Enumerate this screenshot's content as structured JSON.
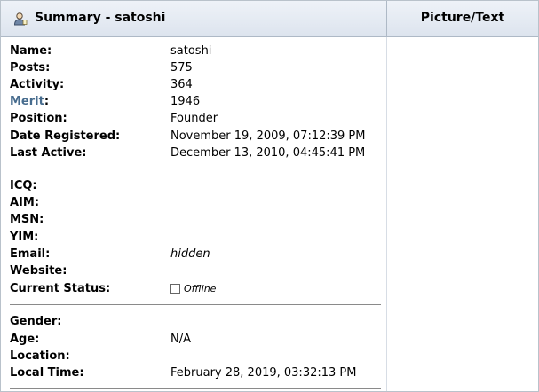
{
  "header": {
    "title": "Summary - satoshi",
    "right_title": "Picture/Text"
  },
  "profile": {
    "name_label": "Name:",
    "name": "satoshi",
    "posts_label": "Posts:",
    "posts": "575",
    "activity_label": "Activity:",
    "activity": "364",
    "merit_label": "Merit",
    "merit_colon": ":",
    "merit": "1946",
    "position_label": "Position:",
    "position": "Founder",
    "registered_label": "Date Registered:",
    "registered": "November 19, 2009, 07:12:39 PM",
    "last_active_label": "Last Active:",
    "last_active": "December 13, 2010, 04:45:41 PM"
  },
  "contact": {
    "icq_label": "ICQ:",
    "aim_label": "AIM:",
    "msn_label": "MSN:",
    "yim_label": "YIM:",
    "email_label": "Email:",
    "email": "hidden",
    "website_label": "Website:",
    "status_label": "Current Status:",
    "status": "Offline"
  },
  "personal": {
    "gender_label": "Gender:",
    "age_label": "Age:",
    "age": "N/A",
    "location_label": "Location:",
    "local_time_label": "Local Time:",
    "local_time": "February 28, 2019, 03:32:13 PM"
  },
  "colors": {
    "header_bg": "#dde4ee",
    "merit_link": "#476c8e",
    "border": "#aeb9c6"
  }
}
